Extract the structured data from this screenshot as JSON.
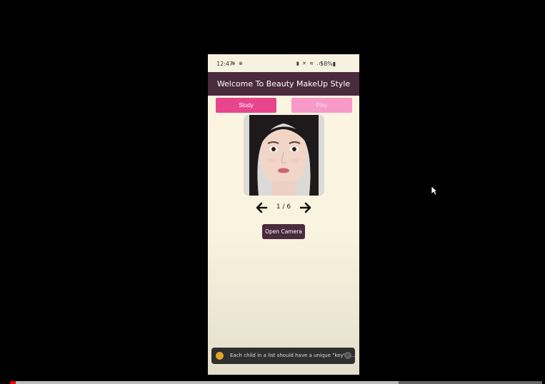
{
  "status_bar": {
    "time": "12:47",
    "left_icons": "⊗ ⊗",
    "right_icons": "▮ ✕ ≋ .ıl",
    "battery": "58%▮"
  },
  "header": {
    "title": "Welcome To Beauty MakeUp Style"
  },
  "tabs": [
    {
      "label": "Study",
      "active": true
    },
    {
      "label": "Play",
      "active": false
    }
  ],
  "carousel": {
    "counter": "1 / 6"
  },
  "camera_button": {
    "label": "Open Camera"
  },
  "toast": {
    "message": "Each child in a list should have a unique \"key\" p...",
    "close_glyph": "✕"
  },
  "video_progress": {
    "played_fraction": 0.73
  },
  "colors": {
    "header_bg": "#4a2a3d",
    "study_tab": "#e8468c",
    "play_tab": "#f79ac7",
    "app_bg": "#fbf5e2"
  },
  "icons": [
    "arrow-left-icon",
    "arrow-right-icon",
    "warning-icon",
    "close-icon",
    "mouse-cursor-icon"
  ]
}
